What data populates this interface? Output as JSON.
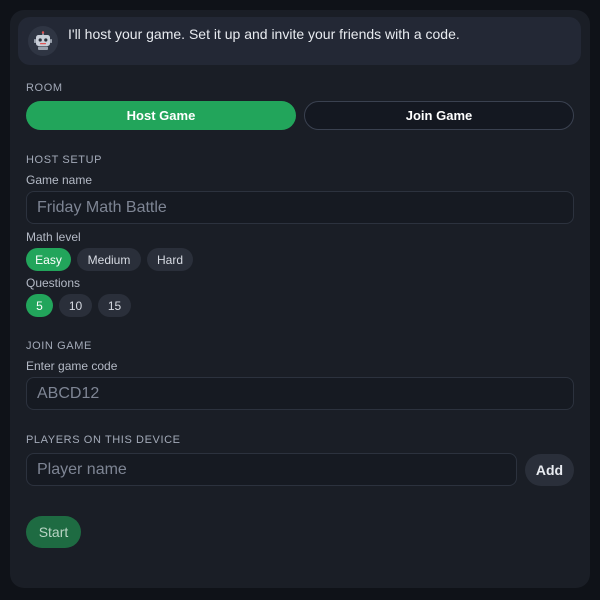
{
  "assistant": {
    "avatar_icon": "robot-icon",
    "message": "I'll host your game. Set it up and invite your friends with a code."
  },
  "room": {
    "section_label": "ROOM",
    "host_label": "Host Game",
    "join_label": "Join Game",
    "selected": "Host Game"
  },
  "host_setup": {
    "section_label": "HOST SETUP",
    "game_name_label": "Game name",
    "game_name_placeholder": "Friday Math Battle",
    "game_name_value": "",
    "math_level_label": "Math level",
    "math_levels": [
      "Easy",
      "Medium",
      "Hard"
    ],
    "math_level_selected": "Easy",
    "questions_label": "Questions",
    "questions_options": [
      "5",
      "10",
      "15"
    ],
    "questions_selected": "5"
  },
  "join_game": {
    "section_label": "JOIN GAME",
    "code_label": "Enter game code",
    "code_placeholder": "ABCD12",
    "code_value": ""
  },
  "players": {
    "section_label": "PLAYERS ON THIS DEVICE",
    "name_placeholder": "Player name",
    "name_value": "",
    "add_label": "Add"
  },
  "start_label": "Start",
  "colors": {
    "accent": "#22a55b",
    "accent_disabled": "#1e6b42",
    "card_bg": "#1a1e26",
    "page_bg": "#0f1218"
  }
}
